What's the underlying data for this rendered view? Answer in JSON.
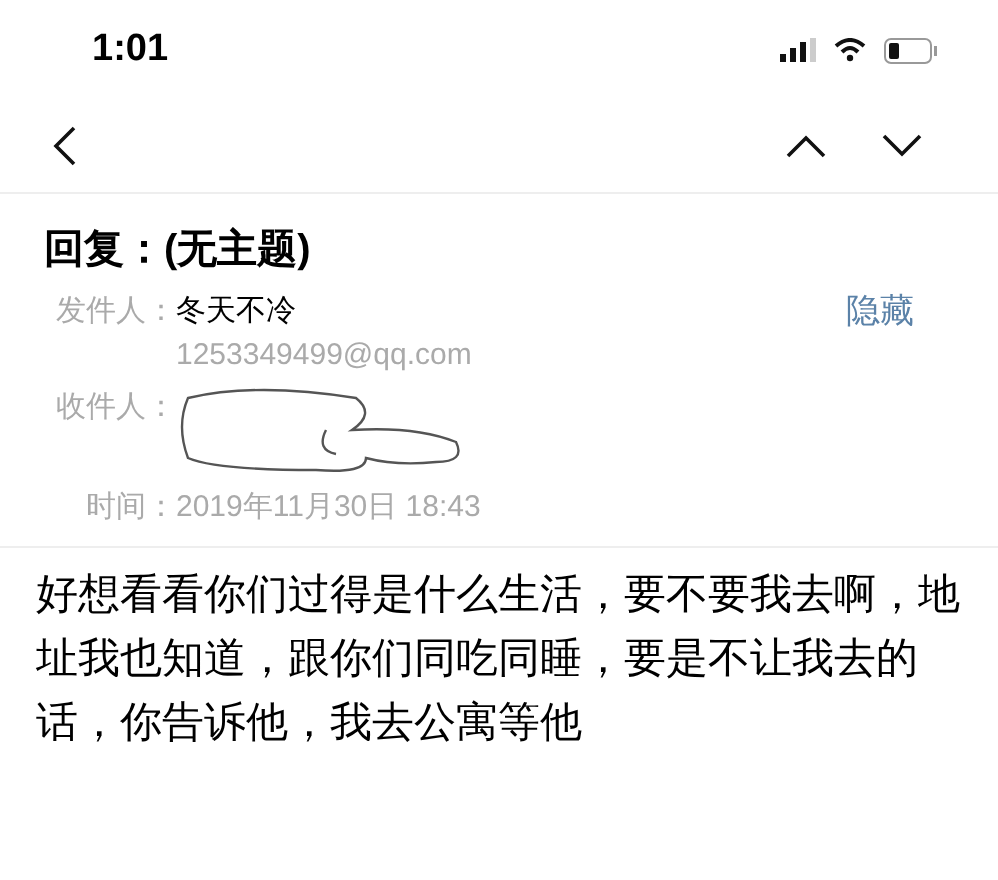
{
  "status_bar": {
    "time": "1:01"
  },
  "message": {
    "subject": "回复：(无主题)",
    "sender": {
      "label": "发件人：",
      "name": "冬天不冷",
      "address": "1253349499@qq.com",
      "action": "隐藏"
    },
    "recipient": {
      "label": "收件人："
    },
    "time": {
      "label": "时间：",
      "value": "2019年11月30日 18:43"
    },
    "body": "好想看看你们过得是什么生活，要不要我去啊，地址我也知道，跟你们同吃同睡，要是不让我去的话，你告诉他，我去公寓等他"
  }
}
